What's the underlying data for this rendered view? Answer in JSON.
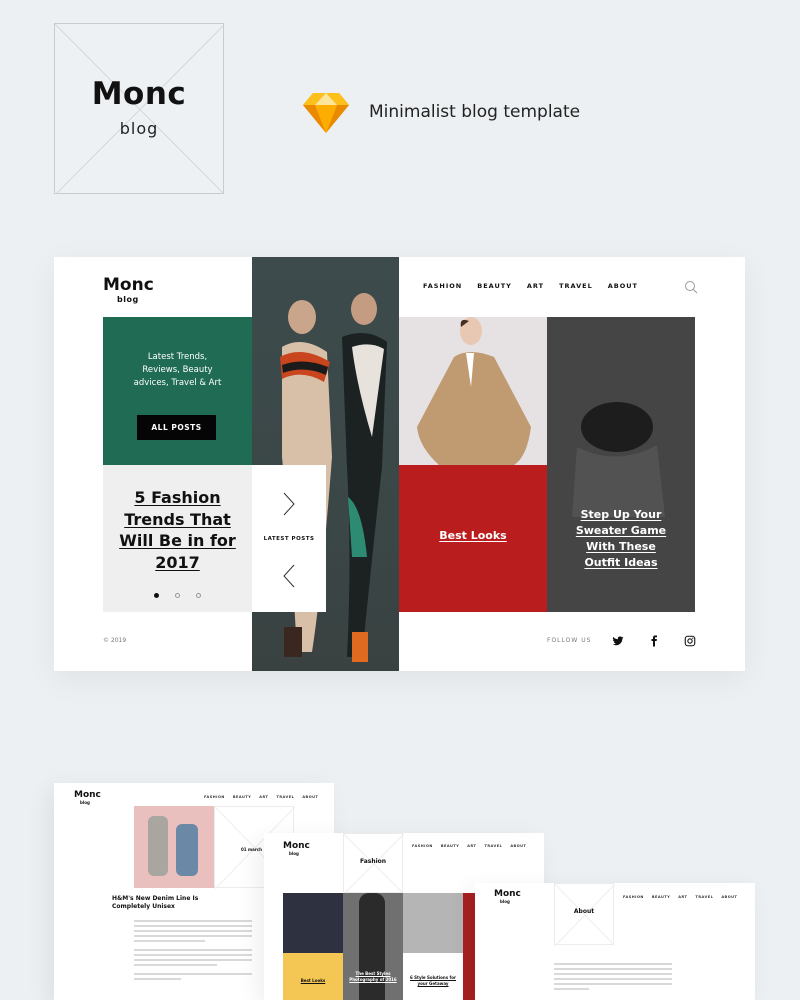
{
  "header": {
    "brand": "Monc",
    "brand_sub": "blog",
    "tagline": "Minimalist blog template",
    "sketch_icon": "sketch-diamond-icon"
  },
  "mock": {
    "logo": {
      "brand": "Monc",
      "sub": "blog"
    },
    "menu": [
      "FASHION",
      "BEAUTY",
      "ART",
      "TRAVEL",
      "ABOUT"
    ],
    "search_icon": "search-icon",
    "hero": {
      "intro": "Latest Trends, Reviews, Beauty advices, Travel & Art",
      "button": "ALL POSTS"
    },
    "featured": {
      "title": "5 Fashion Trends That Will Be in for 2017",
      "slides": 3,
      "active_slide": 1
    },
    "latest_posts_label": "LATEST POSTS",
    "cards": [
      {
        "title": "Best Looks",
        "color": "#b91d1e"
      },
      {
        "title": "Step Up Your Sweater Game With These Outfit Ideas",
        "color": "#454545"
      }
    ],
    "footer": {
      "copyright": "© 2019",
      "follow": "FOLLOW US",
      "social": [
        "twitter-icon",
        "facebook-icon",
        "instagram-icon"
      ]
    },
    "colors": {
      "green": "#1f6b53",
      "red": "#b91d1e",
      "dark": "#454545"
    }
  },
  "previews": {
    "post": {
      "brand": "Monc",
      "sub": "blog",
      "menu": [
        "FASHION",
        "BEAUTY",
        "ART",
        "TRAVEL",
        "ABOUT"
      ],
      "date": "01 march",
      "title": "H&M's New Denim Line Is Completely Unisex"
    },
    "category": {
      "brand": "Monc",
      "sub": "blog",
      "menu": [
        "FASHION",
        "BEAUTY",
        "ART",
        "TRAVEL",
        "ABOUT"
      ],
      "heading": "Fashion",
      "cards": [
        "Best Looks",
        "The Best Styles Photography of 2016",
        "6 Style Solutions for your Getaway"
      ]
    },
    "about": {
      "brand": "Monc",
      "sub": "blog",
      "menu": [
        "FASHION",
        "BEAUTY",
        "ART",
        "TRAVEL",
        "ABOUT"
      ],
      "heading": "About"
    }
  }
}
